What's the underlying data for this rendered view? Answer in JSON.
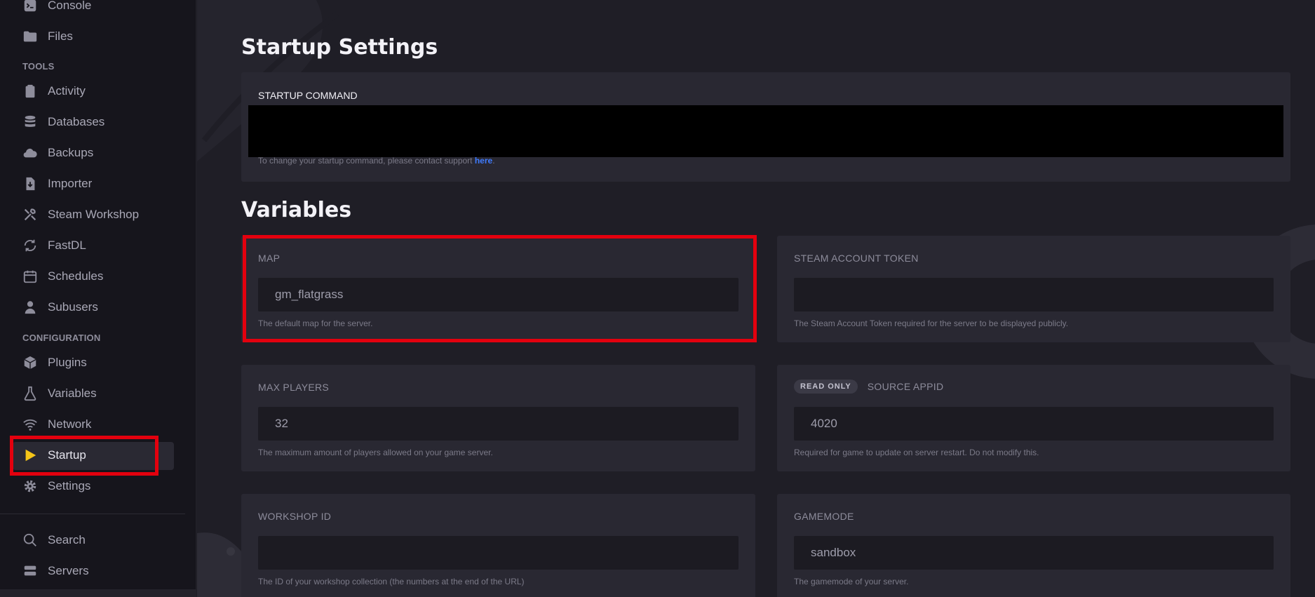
{
  "sidebar": {
    "top_items": [
      {
        "label": "Console",
        "icon": "terminal-icon"
      },
      {
        "label": "Files",
        "icon": "folder-icon"
      }
    ],
    "tools_heading": "TOOLS",
    "tools_items": [
      {
        "label": "Activity",
        "icon": "clipboard-icon"
      },
      {
        "label": "Databases",
        "icon": "database-icon"
      },
      {
        "label": "Backups",
        "icon": "cloud-icon"
      },
      {
        "label": "Importer",
        "icon": "file-import-icon"
      },
      {
        "label": "Steam Workshop",
        "icon": "tools-icon"
      },
      {
        "label": "FastDL",
        "icon": "sync-icon"
      },
      {
        "label": "Schedules",
        "icon": "calendar-icon"
      },
      {
        "label": "Subusers",
        "icon": "user-icon"
      }
    ],
    "config_heading": "CONFIGURATION",
    "config_items": [
      {
        "label": "Plugins",
        "icon": "box-icon"
      },
      {
        "label": "Variables",
        "icon": "flask-icon"
      },
      {
        "label": "Network",
        "icon": "wifi-icon"
      },
      {
        "label": "Startup",
        "icon": "play-icon",
        "active": true
      },
      {
        "label": "Settings",
        "icon": "gear-icon"
      }
    ],
    "bottom_items": [
      {
        "label": "Search",
        "icon": "search-icon"
      },
      {
        "label": "Servers",
        "icon": "servers-icon"
      }
    ]
  },
  "colors": {
    "accent_yellow": "#f5c518",
    "link_blue": "#3f7bff",
    "highlight_red": "#e3000e"
  },
  "startup": {
    "title": "Startup Settings",
    "command_label": "STARTUP COMMAND",
    "help_prefix": "To change your startup command, please contact support ",
    "help_link": "here",
    "help_suffix": "."
  },
  "variables": {
    "title": "Variables",
    "items": [
      {
        "label": "MAP",
        "value": "gm_flatgrass",
        "help": "The default map for the server."
      },
      {
        "label": "STEAM ACCOUNT TOKEN",
        "value": "",
        "help": "The Steam Account Token required for the server to be displayed publicly."
      },
      {
        "label": "MAX PLAYERS",
        "value": "32",
        "help": "The maximum amount of players allowed on your game server."
      },
      {
        "label": "SOURCE APPID",
        "badge": "READ ONLY",
        "value": "4020",
        "help": "Required for game to update on server restart. Do not modify this."
      },
      {
        "label": "WORKSHOP ID",
        "value": "",
        "help": "The ID of your workshop collection (the numbers at the end of the URL)"
      },
      {
        "label": "GAMEMODE",
        "value": "sandbox",
        "help": "The gamemode of your server."
      }
    ]
  }
}
